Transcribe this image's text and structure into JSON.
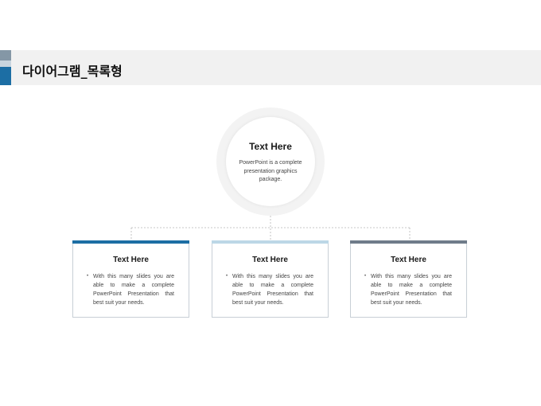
{
  "page_title": "다이어그램_목록형",
  "colors": {
    "accent_dark": "#1c6ea4",
    "accent_light": "#c9d5de",
    "accent_gray": "#8497a6"
  },
  "center": {
    "title": "Text Here",
    "text": "PowerPoint is a complete presentation graphics package."
  },
  "boxes": [
    {
      "title": "Text Here",
      "bullet": "•",
      "text": "With this many slides you are able to make a complete PowerPoint Presentation that best suit your needs.",
      "color": "#1c6ea4"
    },
    {
      "title": "Text Here",
      "bullet": "•",
      "text": "With this many slides you are able to make a complete PowerPoint Presentation that best suit your needs.",
      "color": "#bcd7e6"
    },
    {
      "title": "Text Here",
      "bullet": "•",
      "text": "With this many slides you are able to make a complete PowerPoint Presentation that best suit your needs.",
      "color": "#6f7c8a"
    }
  ]
}
